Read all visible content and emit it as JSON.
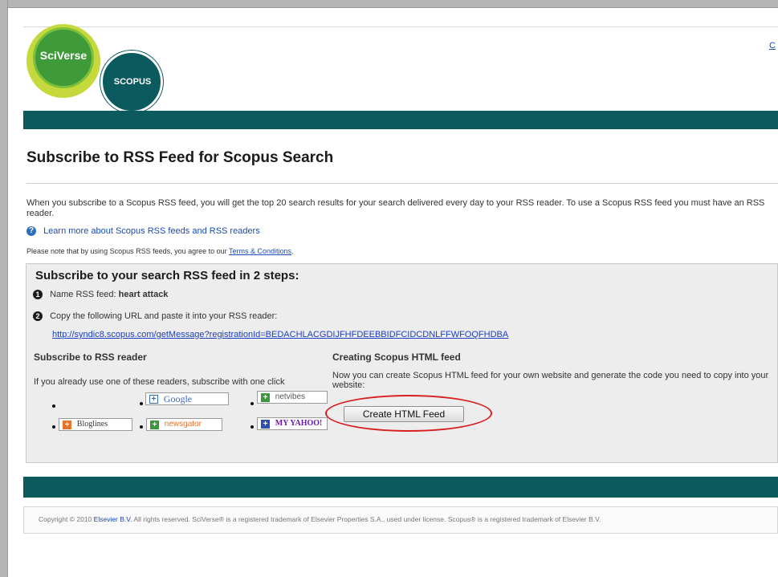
{
  "header": {
    "logo_sciverse": "SciVerse",
    "logo_scopus": "SCOPUS",
    "top_link": "C"
  },
  "main": {
    "title": "Subscribe to RSS Feed for Scopus Search",
    "intro": "When you subscribe to a Scopus RSS feed, you will get the top 20 search results for your search delivered every day to your RSS reader. To use a Scopus RSS feed you must have an RSS reader.",
    "help_icon": "?",
    "help_link": "Learn more about Scopus RSS feeds and RSS readers",
    "terms_prefix": "Please note that by using Scopus RSS feeds, you agree to our",
    "terms_link": "Terms & Conditions",
    "terms_suffix": "."
  },
  "box": {
    "title": "Subscribe to your search RSS feed in 2 steps:",
    "step1_num": "1",
    "step1_label": "Name RSS feed:",
    "step1_value": "heart attack",
    "step2_num": "2",
    "step2_label": "Copy the following URL and paste it into your RSS reader:",
    "feed_url": "http://syndic8.scopus.com/getMessage?registrationId=BEDACHLACGDIJFHFDEEBBIDFCIDCDNLFFWFOQFHDBA",
    "reader_heading": "Subscribe to RSS reader",
    "reader_intro": "If you already use one of these readers, subscribe with one click",
    "html_heading": "Creating Scopus HTML feed",
    "html_intro": "Now you can create Scopus HTML feed for your own website and generate the code you need to copy into your website:",
    "html_button": "Create HTML Feed"
  },
  "readers": {
    "google": "Google",
    "netvibes": "netvibes",
    "bloglines": "Bloglines",
    "newsgator": "newsgator",
    "yahoo": "MY YAHOO!"
  },
  "footer": {
    "copyright_prefix": "Copyright © 2010",
    "elsevier_link": "Elsevier B.V.",
    "copyright_suffix": "All rights reserved. SciVerse® is a registered trademark of Elsevier Properties S.A., used under license. Scopus® is a registered trademark of Elsevier B.V."
  },
  "colors": {
    "brand_teal": "#0b5a5e",
    "link_blue": "#1a4bb8",
    "highlight_red": "#d81e1e"
  }
}
